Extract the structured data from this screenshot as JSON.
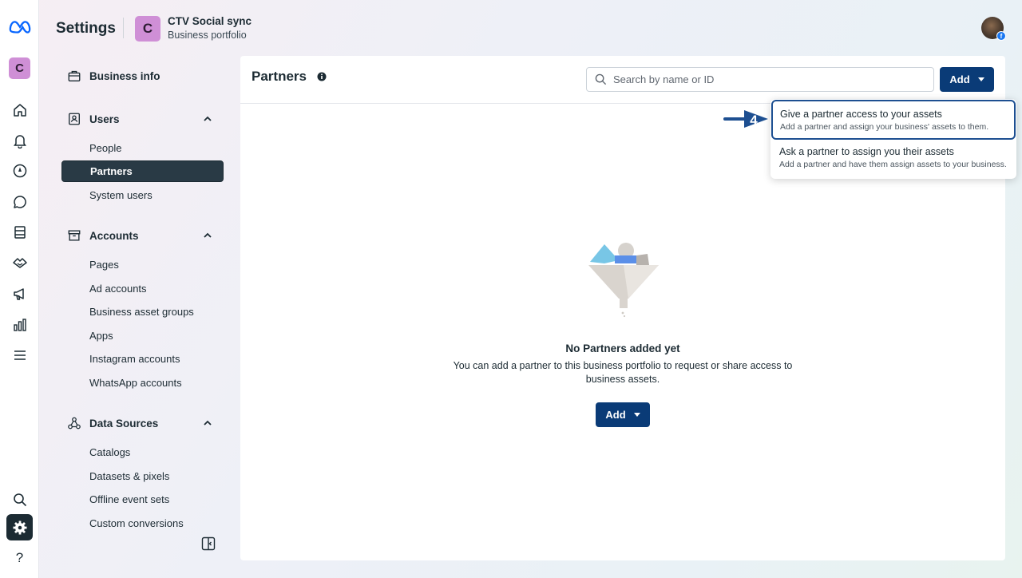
{
  "header": {
    "title": "Settings",
    "business_initial": "C",
    "business_name": "CTV Social sync",
    "business_subtitle": "Business portfolio"
  },
  "rail": {
    "portfolio_initial": "C",
    "items": [
      "home-icon",
      "bell-icon",
      "compass-icon",
      "chat-icon",
      "pages-icon",
      "handshake-icon",
      "megaphone-icon",
      "bar-chart-icon",
      "menu-icon"
    ],
    "bottom": [
      "search-icon",
      "gear-icon",
      "help-icon"
    ],
    "help_label": "?"
  },
  "sidebar": {
    "business_info": "Business info",
    "users": {
      "label": "Users",
      "items": [
        "People",
        "Partners",
        "System users"
      ]
    },
    "accounts": {
      "label": "Accounts",
      "items": [
        "Pages",
        "Ad accounts",
        "Business asset groups",
        "Apps",
        "Instagram accounts",
        "WhatsApp accounts"
      ]
    },
    "data_sources": {
      "label": "Data Sources",
      "items": [
        "Catalogs",
        "Datasets & pixels",
        "Offline event sets",
        "Custom conversions"
      ]
    },
    "active_item": "Partners"
  },
  "main": {
    "title": "Partners",
    "search_placeholder": "Search by name or ID",
    "add_label": "Add",
    "dropdown": [
      {
        "title": "Give a partner access to your assets",
        "subtitle": "Add a partner and assign your business' assets to them."
      },
      {
        "title": "Ask a partner to assign you their assets",
        "subtitle": "Add a partner and have them assign assets to your business."
      }
    ],
    "step_number": "4",
    "empty_title": "No Partners added yet",
    "empty_description": "You can add a partner to this business portfolio to request or share access to business assets.",
    "empty_add_label": "Add"
  },
  "colors": {
    "primary_button": "#0a3b77",
    "active_nav": "#293a45",
    "highlight_border": "#1d4f91",
    "portfolio_tile": "#cf8fd6"
  }
}
